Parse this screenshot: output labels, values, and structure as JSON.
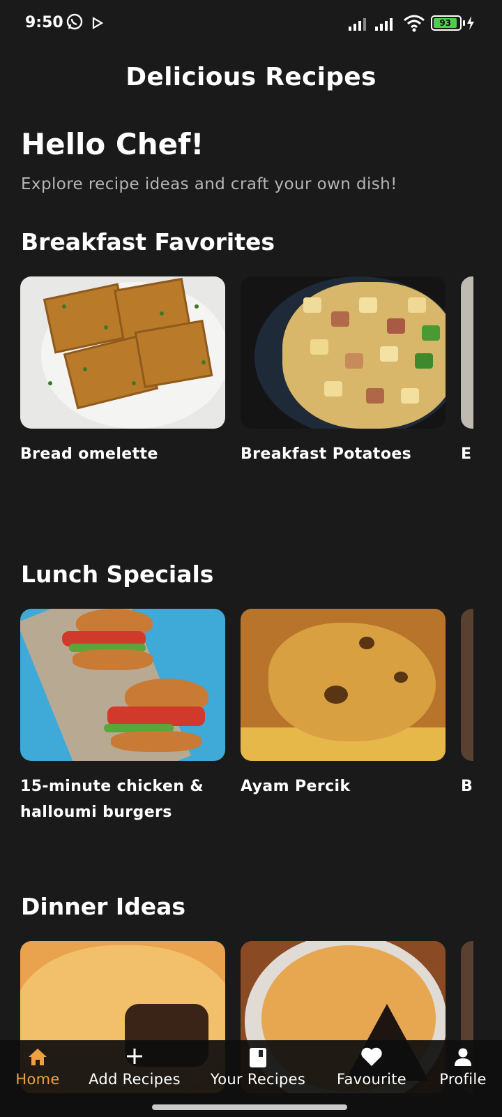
{
  "status_bar": {
    "time": "9:50",
    "battery_level": "93",
    "battery_color": "#4cd04a"
  },
  "header": {
    "title": "Delicious Recipes"
  },
  "greeting": {
    "title": "Hello Chef!",
    "subtitle": "Explore recipe ideas and craft your own dish!"
  },
  "sections": [
    {
      "title": "Breakfast Favorites",
      "cards": [
        {
          "label": "Bread omelette"
        },
        {
          "label": "Breakfast Potatoes"
        },
        {
          "label": "E"
        }
      ]
    },
    {
      "title": "Lunch Specials",
      "cards": [
        {
          "label": "15-minute chicken & halloumi burgers"
        },
        {
          "label": "Ayam Percik"
        },
        {
          "label": "B"
        }
      ]
    },
    {
      "title": "Dinner Ideas",
      "cards": [
        {
          "label": ""
        },
        {
          "label": ""
        },
        {
          "label": ""
        }
      ]
    }
  ],
  "bottom_nav": {
    "active_color": "#f0a040",
    "items": [
      {
        "label": "Home",
        "icon": "home-icon",
        "active": true
      },
      {
        "label": "Add Recipes",
        "icon": "plus-icon"
      },
      {
        "label": "Your Recipes",
        "icon": "book-icon"
      },
      {
        "label": "Favourite",
        "icon": "heart-icon"
      },
      {
        "label": "Profile",
        "icon": "person-icon"
      }
    ]
  }
}
